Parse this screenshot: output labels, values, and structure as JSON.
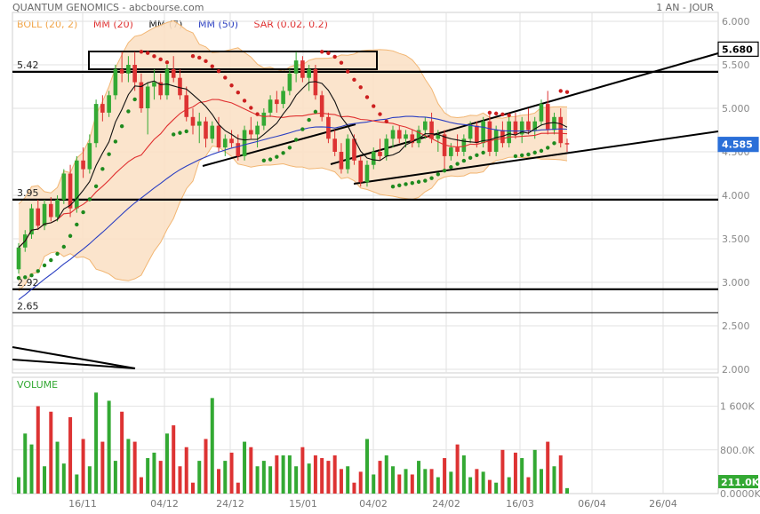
{
  "header": {
    "title": "QUANTUM GENOMICS - abcbourse.com",
    "period": "1 AN - JOUR"
  },
  "legend": {
    "boll": "BOLL (20, 2)",
    "mm20": "MM (20)",
    "mm7": "MM (7)",
    "mm50": "MM (50)",
    "sar": "SAR (0.02, 0.2)"
  },
  "colors": {
    "up": "#33a933",
    "down": "#dd3333",
    "boll_fill": "#fbe1c6",
    "boll_line": "#f2b673",
    "mm20": "#e03030",
    "mm7": "#111111",
    "mm50": "#2b3fc2",
    "last_price_box": "#2a6fd8",
    "grid": "#e2e2e2"
  },
  "chart_data": [
    {
      "type": "candlestick",
      "title": "",
      "ylim": [
        2.0,
        6.0
      ],
      "y_ticks": [
        "6.000",
        "5.500",
        "5.000",
        "4.500",
        "4.000",
        "3.500",
        "3.000",
        "2.500",
        "2.000"
      ],
      "x_tick_labels": [
        "16/11",
        "04/12",
        "24/12",
        "15/01",
        "04/02",
        "24/02",
        "16/03",
        "06/04",
        "26/04"
      ],
      "horizontal_levels": [
        {
          "value": 5.42,
          "label": "5.42"
        },
        {
          "value": 3.95,
          "label": "3.95"
        },
        {
          "value": 2.92,
          "label": "2.92"
        },
        {
          "value": 2.65,
          "label": "2.65"
        }
      ],
      "price_badges": [
        {
          "value": 5.68,
          "label": "5.680",
          "style": "outline"
        },
        {
          "value": 4.585,
          "label": "4.585",
          "style": "filled"
        }
      ],
      "candles": [
        [
          3.15,
          3.45,
          3.1,
          3.4
        ],
        [
          3.4,
          3.6,
          3.35,
          3.55
        ],
        [
          3.55,
          3.9,
          3.5,
          3.85
        ],
        [
          3.85,
          3.95,
          3.6,
          3.65
        ],
        [
          3.65,
          3.95,
          3.6,
          3.9
        ],
        [
          3.9,
          3.98,
          3.7,
          3.75
        ],
        [
          3.75,
          4.0,
          3.7,
          3.95
        ],
        [
          3.95,
          4.3,
          3.9,
          4.25
        ],
        [
          4.25,
          4.35,
          3.75,
          3.85
        ],
        [
          3.85,
          4.45,
          3.8,
          4.4
        ],
        [
          4.4,
          4.55,
          4.2,
          4.3
        ],
        [
          4.3,
          4.7,
          4.25,
          4.6
        ],
        [
          4.6,
          5.1,
          4.55,
          5.05
        ],
        [
          5.05,
          5.15,
          4.85,
          4.95
        ],
        [
          4.95,
          5.2,
          4.9,
          5.15
        ],
        [
          5.15,
          5.5,
          5.1,
          5.45
        ],
        [
          5.45,
          5.65,
          5.3,
          5.4
        ],
        [
          5.4,
          5.6,
          5.3,
          5.5
        ],
        [
          5.5,
          5.65,
          5.2,
          5.3
        ],
        [
          5.3,
          5.4,
          4.95,
          5.0
        ],
        [
          5.0,
          5.3,
          4.7,
          5.25
        ],
        [
          5.25,
          5.45,
          5.1,
          5.3
        ],
        [
          5.3,
          5.4,
          5.1,
          5.15
        ],
        [
          5.15,
          5.5,
          5.1,
          5.45
        ],
        [
          5.45,
          5.6,
          5.3,
          5.35
        ],
        [
          5.35,
          5.45,
          5.1,
          5.15
        ],
        [
          5.15,
          5.25,
          4.85,
          4.9
        ],
        [
          4.9,
          5.0,
          4.7,
          4.8
        ],
        [
          4.8,
          4.95,
          4.6,
          4.85
        ],
        [
          4.85,
          4.9,
          4.55,
          4.65
        ],
        [
          4.65,
          4.85,
          4.6,
          4.8
        ],
        [
          4.8,
          4.9,
          4.5,
          4.55
        ],
        [
          4.55,
          4.7,
          4.45,
          4.65
        ],
        [
          4.65,
          4.75,
          4.55,
          4.6
        ],
        [
          4.6,
          4.7,
          4.4,
          4.45
        ],
        [
          4.45,
          4.8,
          4.4,
          4.75
        ],
        [
          4.75,
          4.9,
          4.65,
          4.7
        ],
        [
          4.7,
          4.85,
          4.55,
          4.8
        ],
        [
          4.8,
          5.0,
          4.75,
          4.95
        ],
        [
          4.95,
          5.15,
          4.9,
          5.1
        ],
        [
          5.1,
          5.2,
          4.95,
          5.05
        ],
        [
          5.05,
          5.25,
          5.0,
          5.2
        ],
        [
          5.2,
          5.45,
          5.15,
          5.4
        ],
        [
          5.4,
          5.65,
          5.3,
          5.55
        ],
        [
          5.55,
          5.6,
          5.3,
          5.35
        ],
        [
          5.35,
          5.5,
          5.2,
          5.45
        ],
        [
          5.45,
          5.5,
          5.1,
          5.15
        ],
        [
          5.15,
          5.2,
          4.85,
          4.9
        ],
        [
          4.9,
          4.95,
          4.6,
          4.65
        ],
        [
          4.65,
          4.75,
          4.45,
          4.5
        ],
        [
          4.5,
          4.6,
          4.25,
          4.3
        ],
        [
          4.3,
          4.7,
          4.25,
          4.65
        ],
        [
          4.65,
          4.7,
          4.35,
          4.4
        ],
        [
          4.4,
          4.45,
          4.1,
          4.15
        ],
        [
          4.15,
          4.4,
          4.1,
          4.35
        ],
        [
          4.35,
          4.55,
          4.3,
          4.5
        ],
        [
          4.5,
          4.65,
          4.4,
          4.45
        ],
        [
          4.45,
          4.7,
          4.4,
          4.65
        ],
        [
          4.65,
          4.8,
          4.55,
          4.75
        ],
        [
          4.75,
          4.8,
          4.6,
          4.65
        ],
        [
          4.65,
          4.75,
          4.55,
          4.7
        ],
        [
          4.7,
          4.75,
          4.55,
          4.6
        ],
        [
          4.6,
          4.8,
          4.55,
          4.75
        ],
        [
          4.75,
          4.9,
          4.65,
          4.85
        ],
        [
          4.85,
          4.95,
          4.6,
          4.65
        ],
        [
          4.65,
          4.75,
          4.5,
          4.7
        ],
        [
          4.7,
          4.75,
          4.3,
          4.45
        ],
        [
          4.45,
          4.6,
          4.4,
          4.55
        ],
        [
          4.55,
          4.7,
          4.45,
          4.5
        ],
        [
          4.5,
          4.7,
          4.45,
          4.65
        ],
        [
          4.65,
          4.85,
          4.6,
          4.8
        ],
        [
          4.8,
          4.85,
          4.55,
          4.6
        ],
        [
          4.6,
          4.9,
          4.55,
          4.85
        ],
        [
          4.85,
          4.95,
          4.45,
          4.5
        ],
        [
          4.5,
          4.8,
          4.45,
          4.75
        ],
        [
          4.75,
          4.85,
          4.55,
          4.6
        ],
        [
          4.6,
          4.9,
          4.55,
          4.85
        ],
        [
          4.85,
          4.95,
          4.65,
          4.7
        ],
        [
          4.7,
          4.9,
          4.6,
          4.85
        ],
        [
          4.85,
          5.0,
          4.7,
          4.75
        ],
        [
          4.75,
          4.9,
          4.65,
          4.85
        ],
        [
          4.85,
          5.1,
          4.8,
          5.05
        ],
        [
          5.05,
          5.2,
          4.7,
          4.75
        ],
        [
          4.75,
          4.95,
          4.7,
          4.9
        ],
        [
          4.9,
          5.0,
          4.55,
          4.6
        ],
        [
          4.6,
          4.65,
          4.5,
          4.585
        ]
      ],
      "volume": {
        "label": "VOLUME",
        "ylim": [
          0,
          2000
        ],
        "y_ticks": [
          "1 600K",
          "800.0K",
          "0.0000K"
        ],
        "last_label": "211.0K",
        "values": [
          300,
          1100,
          900,
          1600,
          500,
          1500,
          950,
          550,
          1400,
          350,
          1000,
          500,
          1850,
          950,
          1700,
          600,
          1500,
          1000,
          950,
          300,
          650,
          750,
          600,
          1100,
          1250,
          500,
          850,
          200,
          600,
          1000,
          1750,
          450,
          600,
          750,
          200,
          950,
          850,
          500,
          600,
          500,
          700,
          700,
          700,
          500,
          850,
          550,
          700,
          650,
          600,
          700,
          450,
          500,
          200,
          400,
          1000,
          350,
          600,
          700,
          500,
          350,
          450,
          350,
          600,
          450,
          450,
          300,
          650,
          400,
          900,
          700,
          300,
          450,
          400,
          250,
          200,
          800,
          300,
          750,
          650,
          300,
          800,
          450,
          950,
          500,
          700,
          100
        ],
        "up": [
          1,
          1,
          1,
          0,
          1,
          0,
          1,
          1,
          0,
          1,
          0,
          1,
          1,
          0,
          1,
          1,
          0,
          1,
          0,
          0,
          1,
          1,
          0,
          1,
          0,
          0,
          0,
          0,
          1,
          0,
          1,
          0,
          1,
          0,
          0,
          1,
          0,
          1,
          1,
          1,
          0,
          1,
          1,
          1,
          0,
          1,
          0,
          0,
          0,
          0,
          0,
          1,
          0,
          0,
          1,
          1,
          0,
          1,
          1,
          0,
          1,
          0,
          1,
          1,
          0,
          1,
          0,
          1,
          0,
          1,
          1,
          0,
          1,
          0,
          1,
          0,
          1,
          0,
          1,
          0,
          1,
          1,
          0,
          1,
          0,
          1
        ]
      },
      "upper_channel": [
        [
          372,
          185
        ],
        [
          808,
          60
        ]
      ],
      "lower_channel": [
        [
          398,
          207
        ],
        [
          808,
          148
        ]
      ],
      "rect_box": [
        [
          100,
          58
        ],
        [
          424,
          78
        ]
      ],
      "support_line": [
        [
          228,
          187
        ],
        [
          400,
          140
        ]
      ],
      "extra_lines": [
        [
          [
            14,
            391
          ],
          [
            152,
            415
          ]
        ],
        [
          [
            14,
            405
          ],
          [
            152,
            415
          ]
        ]
      ]
    }
  ]
}
